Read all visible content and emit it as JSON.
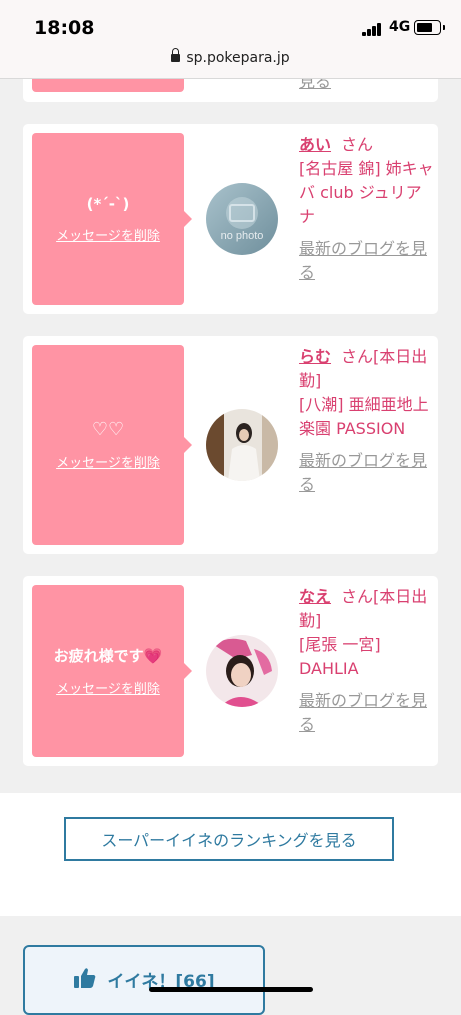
{
  "status_bar": {
    "time": "18:08",
    "network": "4G"
  },
  "browser": {
    "url": "sp.pokepara.jp"
  },
  "messages": [
    {
      "bubble_text": "",
      "delete_label": "",
      "blog_link": "見る"
    },
    {
      "bubble_text": "(*´-`)",
      "delete_label": "メッセージを削除",
      "name": "あい",
      "suffix": "さん",
      "shop": "[名古屋 錦] 姉キャバ club ジュリアナ",
      "avatar_text": "no photo",
      "blog_link": "最新のブログを見る"
    },
    {
      "bubble_text": "♡♡",
      "delete_label": "メッセージを削除",
      "name": "らむ",
      "suffix": "さん[本日出勤]",
      "shop": "[八潮] 亜細亜地上楽園 PASSION",
      "blog_link": "最新のブログを見る"
    },
    {
      "bubble_text": "お疲れ様です💗",
      "delete_label": "メッセージを削除",
      "name": "なえ",
      "suffix": "さん[本日出勤]",
      "shop": "[尾張 一宮] DAHLIA",
      "blog_link": "最新のブログを見る"
    }
  ],
  "ranking_button": "スーパーイイネのランキングを見る",
  "like_button": {
    "label": "イイネ！[66]"
  },
  "colors": {
    "pink": "#ff94a4",
    "name_pink": "#d94070",
    "blue": "#2f7aa0"
  }
}
